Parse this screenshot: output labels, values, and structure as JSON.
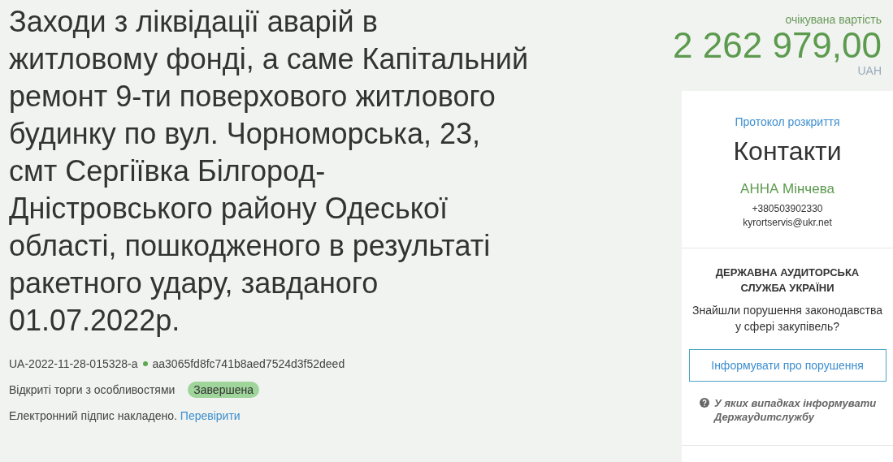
{
  "tender": {
    "title": "Заходи з ліквідації аварій в житловому фонді, а саме Капітальний ремонт 9-ти поверхового житлового будинку по вул. Чорноморська, 23, смт Сергіївка Білгород-Дністровського району Одеської області, пошкодженого в результаті ракетного удару, завданого 01.07.2022р.",
    "id": "UA-2022-11-28-015328-a",
    "hash": "aa3065fd8fc741b8aed7524d3f52deed",
    "procedure": "Відкриті торги з особливостями",
    "status": "Завершена",
    "signature_text": "Електронний підпис накладено.",
    "signature_link": "Перевірити"
  },
  "price": {
    "label": "очікувана вартість",
    "amount": "2 262 979,00",
    "currency": "UAH"
  },
  "contacts": {
    "protocol_link": "Протокол розкриття",
    "heading": "Контакти",
    "name": "АННА Мінчева",
    "phone": "+380503902330",
    "email": "kyrortservis@ukr.net"
  },
  "audit": {
    "heading": "ДЕРЖАВНА АУДИТОРСЬКА СЛУЖБА УКРАЇНИ",
    "question": "Знайшли порушення законодавства у сфері закупівель?",
    "button": "Інформувати про порушення",
    "help_link": "У яких випадках інформувати Держаудитслужбу"
  }
}
